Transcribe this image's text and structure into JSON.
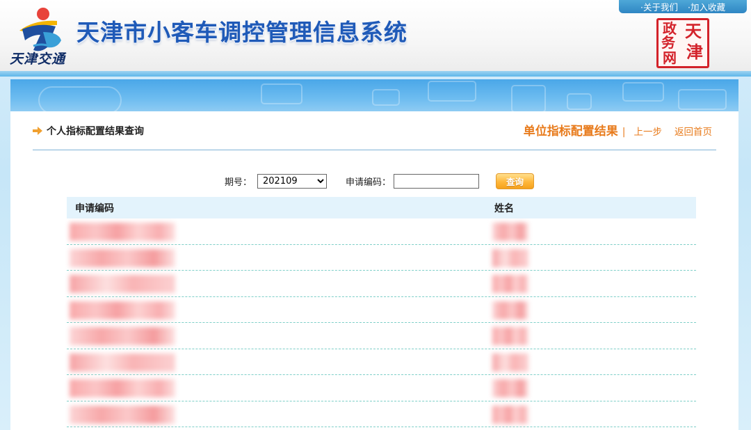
{
  "header": {
    "site_title": "天津市小客车调控管理信息系统",
    "logo_text": "天津交通",
    "top_links": [
      "·关于我们",
      "·加入收藏"
    ],
    "seal_chars": [
      "天",
      "津",
      "政",
      "务",
      "网"
    ]
  },
  "breadcrumb": {
    "title": "个人指标配置结果查询"
  },
  "nav_links": {
    "unit_results": "单位指标配置结果",
    "separator": "|",
    "prev": "上一步",
    "home": "返回首页"
  },
  "search": {
    "period_label": "期号：",
    "period_value": "202109",
    "code_label": "申请编码：",
    "code_value": "",
    "query_button": "查询"
  },
  "table": {
    "columns": [
      "申请编码",
      "姓名"
    ],
    "rows_note": "8 rows with pixelated/redacted values"
  },
  "colors": {
    "title_blue": "#1f5ab8",
    "link_orange": "#e87b1c",
    "header_row_bg": "#e3f3fc",
    "seal_red": "#d3222a"
  }
}
